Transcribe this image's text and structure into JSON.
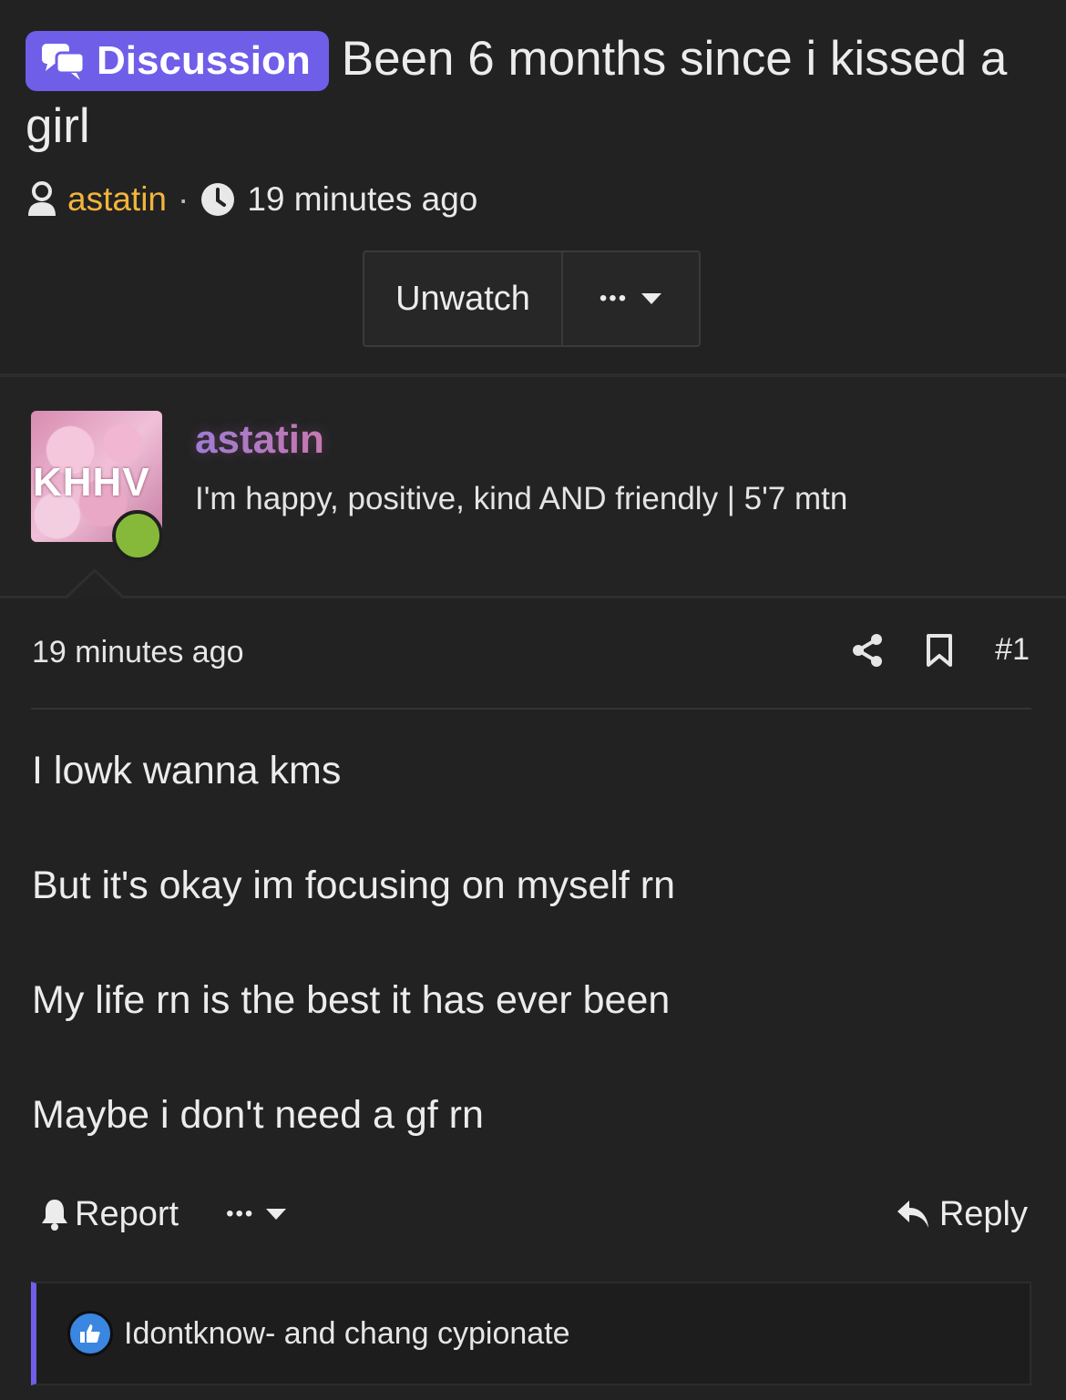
{
  "thread": {
    "badge_label": "Discussion",
    "title": "Been 6 months since i kissed a girl",
    "author": "astatin",
    "separator": "·",
    "time": "19 minutes ago",
    "unwatch_label": "Unwatch",
    "more_label": "•••"
  },
  "author_card": {
    "avatar_text": "KHHV",
    "name": "astatin",
    "bio": "I'm happy, positive, kind AND friendly | 5'7 mtn",
    "online": true
  },
  "post": {
    "time": "19 minutes ago",
    "number": "#1",
    "lines": [
      "I lowk wanna kms",
      "But it's okay im focusing on myself rn",
      "My life rn is the best it has ever been",
      "Maybe i don't need a gf rn"
    ],
    "report_label": "Report",
    "more_label": "•••",
    "reply_label": "Reply",
    "reactions_text": "Idontknow- and chang cypionate"
  },
  "colors": {
    "accent": "#6f5ee8",
    "username": "#f2b53a",
    "online": "#86b93a",
    "like": "#3a86e0",
    "background": "#222223"
  }
}
